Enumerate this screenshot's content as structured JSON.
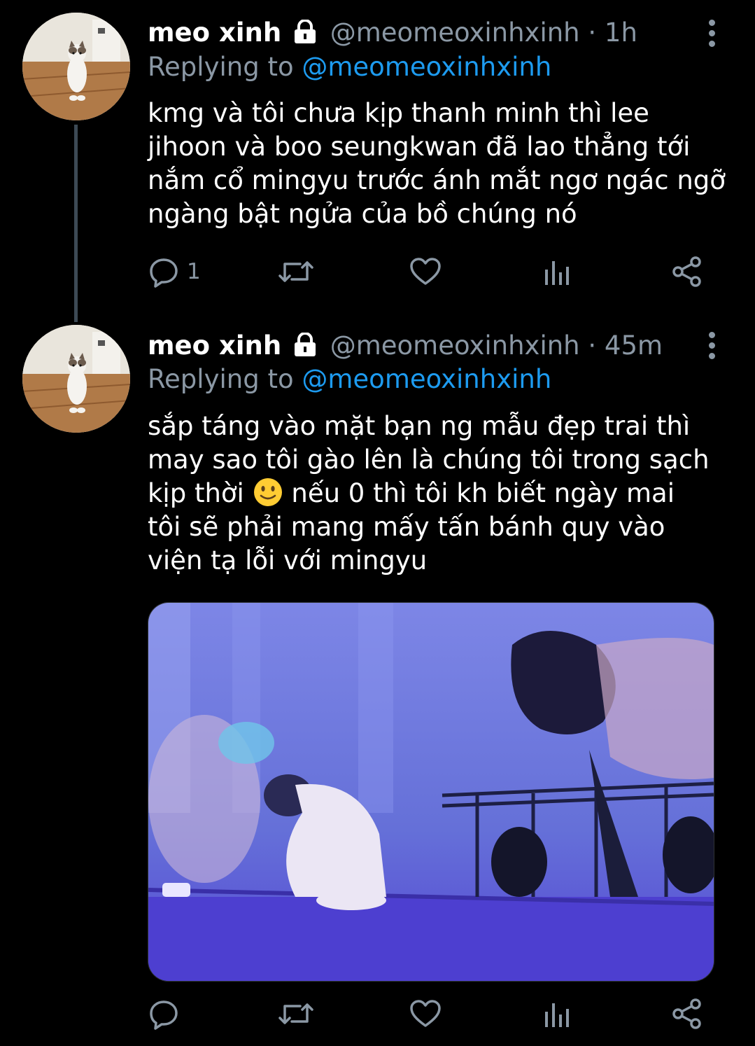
{
  "tweets": [
    {
      "name": "meo xinh",
      "handle": "@meomeoxinhxinh",
      "separator": "·",
      "time": "1h",
      "replying_prefix": "Replying to",
      "replying_to": "@meomeoxinhxinh",
      "text": "kmg và tôi chưa kịp thanh minh thì lee jihoon và boo seungkwan đã lao thẳng tới nắm cổ mingyu trước ánh mắt ngơ ngác ngỡ ngàng bật ngửa của bồ chúng nó",
      "reply_count": "1"
    },
    {
      "name": "meo xinh",
      "handle": "@meomeoxinhxinh",
      "separator": "·",
      "time": "45m",
      "replying_prefix": "Replying to",
      "replying_to": "@meomeoxinhxinh",
      "text_before_emoji": "sắp táng vào mặt bạn ng mẫu đẹp trai thì may sao tôi gào lên là chúng tôi trong sạch kịp thời",
      "text_after_emoji": "nếu 0 thì tôi kh biết ngày mai tôi sẽ phải mang mấy tấn bánh quy vào viện tạ lỗi với mingyu",
      "reply_count": ""
    }
  ],
  "colors": {
    "background": "#000000",
    "secondary_text": "#8b98a5",
    "mention": "#1d9bf0",
    "thread_line": "#3d4a55"
  },
  "icons": {
    "verified_lock": "lock-icon",
    "reply": "reply-icon",
    "retweet": "retweet-icon",
    "like": "heart-icon",
    "analytics": "analytics-icon",
    "share": "share-icon",
    "menu": "more-vertical-icon",
    "emoji": "slightly-smiling-face-icon"
  }
}
